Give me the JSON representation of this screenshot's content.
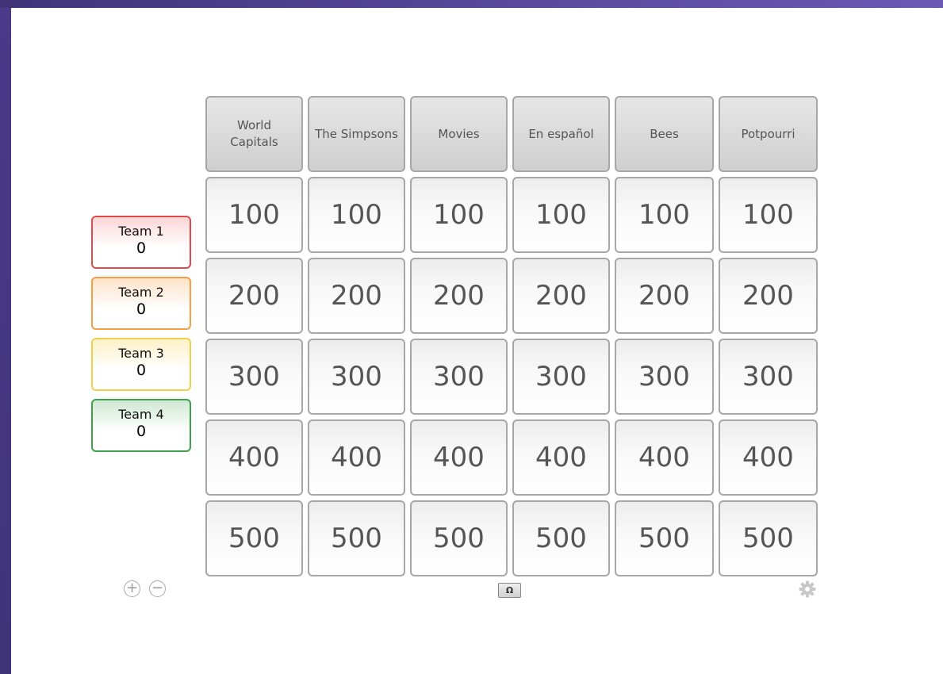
{
  "teams": [
    {
      "name": "Team 1",
      "score": "0",
      "color": "#e34b4b"
    },
    {
      "name": "Team 2",
      "score": "0",
      "color": "#f3a046"
    },
    {
      "name": "Team 3",
      "score": "0",
      "color": "#f2cf4a"
    },
    {
      "name": "Team 4",
      "score": "0",
      "color": "#3fa14a"
    }
  ],
  "board": {
    "categories": [
      "World Capitals",
      "The Simpsons",
      "Movies",
      "En español",
      "Bees",
      "Potpourri"
    ],
    "rows": [
      [
        "100",
        "100",
        "100",
        "100",
        "100",
        "100"
      ],
      [
        "200",
        "200",
        "200",
        "200",
        "200",
        "200"
      ],
      [
        "300",
        "300",
        "300",
        "300",
        "300",
        "300"
      ],
      [
        "400",
        "400",
        "400",
        "400",
        "400",
        "400"
      ],
      [
        "500",
        "500",
        "500",
        "500",
        "500",
        "500"
      ]
    ]
  },
  "controls": {
    "add_team_icon": "plus-circle-icon",
    "add_team_glyph": "+",
    "remove_team_icon": "minus-circle-icon",
    "remove_team_glyph": "−",
    "special_char_label": "Ω",
    "settings_icon": "gear-icon"
  }
}
